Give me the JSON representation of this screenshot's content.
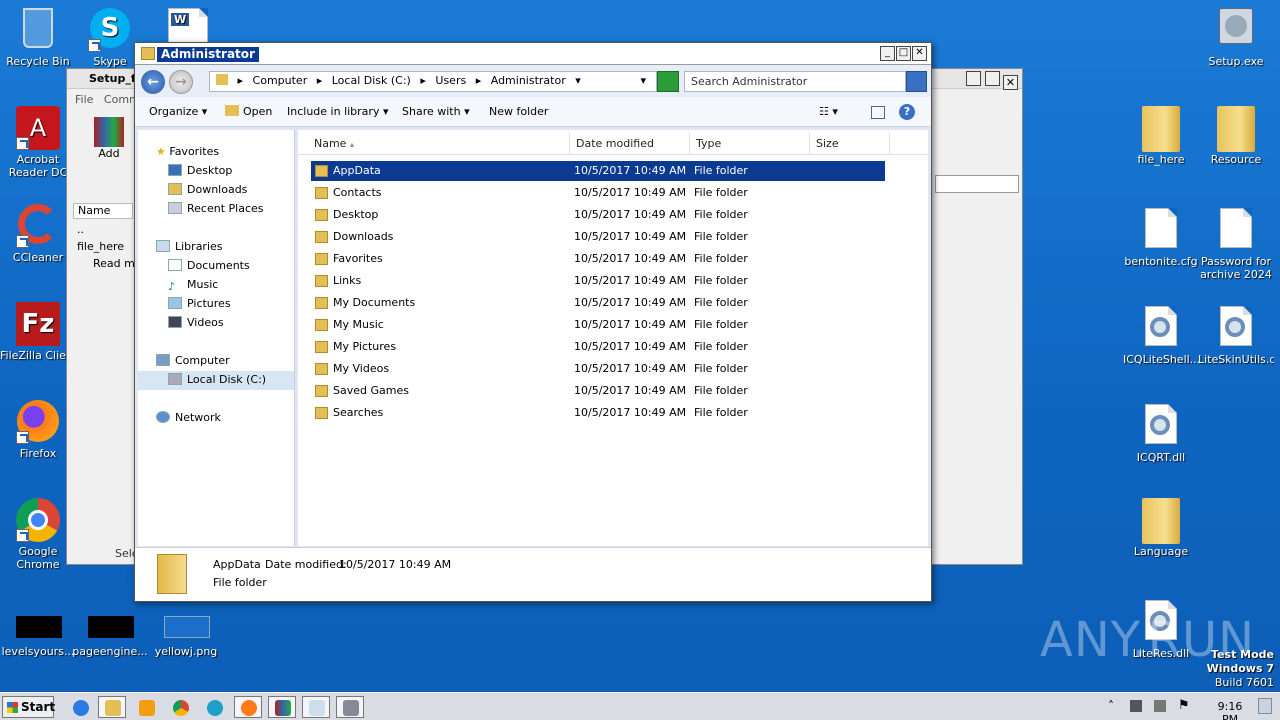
{
  "desktop_icons_left": [
    {
      "label": "Recycle Bin",
      "icon": "recycle-bin-icon"
    },
    {
      "label": "Acrobat Reader DC",
      "icon": "acrobat-icon"
    },
    {
      "label": "CCleaner",
      "icon": "ccleaner-icon"
    },
    {
      "label": "FileZilla Client",
      "icon": "filezilla-icon"
    },
    {
      "label": "Firefox",
      "icon": "firefox-icon"
    },
    {
      "label": "Google Chrome",
      "icon": "chrome-icon"
    }
  ],
  "desktop_top": {
    "skype": "Skype",
    "word": ""
  },
  "desktop_bottom": [
    "levelsyours...",
    "pageengine...",
    "yellowj.png"
  ],
  "desktop_icons_right": [
    {
      "label": "Setup.exe"
    },
    {
      "label": "file_here"
    },
    {
      "label": "Resource"
    },
    {
      "label": "bentonite.cfg"
    },
    {
      "label": "Password for archive 2024"
    },
    {
      "label": "ICQLiteShell..."
    },
    {
      "label": "LiteSkinUtils.dll"
    },
    {
      "label": "ICQRT.dll"
    },
    {
      "label": "Language"
    },
    {
      "label": "LiteRes.dll"
    }
  ],
  "back_window": {
    "title": "Setup_f",
    "menu": [
      "File",
      "Comm"
    ],
    "add": "Add",
    "name_col": "Name",
    "rows": [
      "..",
      "file_here",
      "Read me"
    ],
    "status": "Sele"
  },
  "window": {
    "title": "Administrator",
    "breadcrumb": [
      "Computer",
      "Local Disk (C:)",
      "Users",
      "Administrator"
    ],
    "search_placeholder": "Search Administrator",
    "toolbar": {
      "organize": "Organize",
      "open": "Open",
      "include": "Include in library",
      "share": "Share with",
      "new_folder": "New folder"
    },
    "nav": {
      "favorites": "Favorites",
      "desktop": "Desktop",
      "downloads": "Downloads",
      "recent": "Recent Places",
      "libraries": "Libraries",
      "documents": "Documents",
      "music": "Music",
      "pictures": "Pictures",
      "videos": "Videos",
      "computer": "Computer",
      "local_disk": "Local Disk (C:)",
      "network": "Network"
    },
    "columns": {
      "name": "Name",
      "date": "Date modified",
      "type": "Type",
      "size": "Size"
    },
    "files": [
      {
        "name": "AppData",
        "date": "10/5/2017 10:49 AM",
        "type": "File folder"
      },
      {
        "name": "Contacts",
        "date": "10/5/2017 10:49 AM",
        "type": "File folder"
      },
      {
        "name": "Desktop",
        "date": "10/5/2017 10:49 AM",
        "type": "File folder"
      },
      {
        "name": "Downloads",
        "date": "10/5/2017 10:49 AM",
        "type": "File folder"
      },
      {
        "name": "Favorites",
        "date": "10/5/2017 10:49 AM",
        "type": "File folder"
      },
      {
        "name": "Links",
        "date": "10/5/2017 10:49 AM",
        "type": "File folder"
      },
      {
        "name": "My Documents",
        "date": "10/5/2017 10:49 AM",
        "type": "File folder"
      },
      {
        "name": "My Music",
        "date": "10/5/2017 10:49 AM",
        "type": "File folder"
      },
      {
        "name": "My Pictures",
        "date": "10/5/2017 10:49 AM",
        "type": "File folder"
      },
      {
        "name": "My Videos",
        "date": "10/5/2017 10:49 AM",
        "type": "File folder"
      },
      {
        "name": "Saved Games",
        "date": "10/5/2017 10:49 AM",
        "type": "File folder"
      },
      {
        "name": "Searches",
        "date": "10/5/2017 10:49 AM",
        "type": "File folder"
      }
    ],
    "details": {
      "name": "AppData",
      "date_label": "Date modified:",
      "date": "10/5/2017 10:49 AM",
      "type": "File folder"
    }
  },
  "taskbar": {
    "start": "Start",
    "time": "9:16 PM"
  },
  "watermark": "ANY.RUN",
  "test_mode": [
    "Test Mode",
    "Windows 7",
    "Build 7601"
  ]
}
